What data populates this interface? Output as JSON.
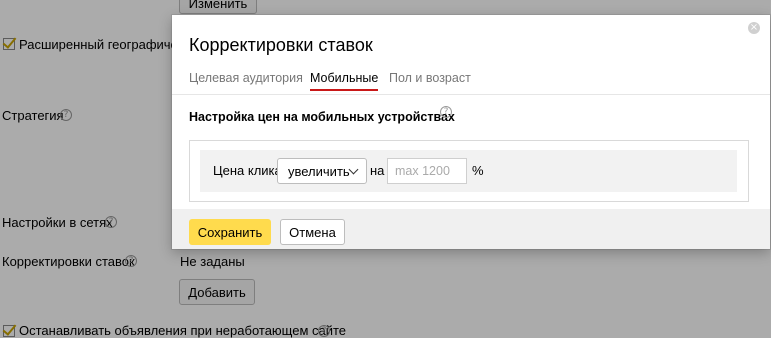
{
  "background": {
    "change_button": "Изменить",
    "extended_geo_label": "Расширенный географический таргетинг",
    "strategy_label": "Стратегия",
    "network_settings_label": "Настройки в сетях",
    "bid_adjustments_label": "Корректировки ставок",
    "bid_adjustments_value": "Не заданы",
    "add_button": "Добавить",
    "stop_ads_label": "Останавливать объявления при неработающем сайте",
    "help_glyph": "?"
  },
  "modal": {
    "title": "Корректировки ставок",
    "close_glyph": "×",
    "tabs": [
      {
        "label": "Целевая аудитория",
        "active": false
      },
      {
        "label": "Мобильные",
        "active": true
      },
      {
        "label": "Пол и возраст",
        "active": false
      }
    ],
    "section_title": "Настройка цен на мобильных устройствах",
    "row": {
      "price_label": "Цена клика",
      "mode_select_value": "увеличить",
      "preposition": "на",
      "amount_placeholder": "max 1200",
      "unit": "%"
    },
    "save_button": "Сохранить",
    "cancel_button": "Отмена"
  },
  "colors": {
    "accent_yellow": "#ffdb4d",
    "active_tab_underline": "#c91818",
    "overlay": "rgba(0,0,0,0.33)"
  }
}
